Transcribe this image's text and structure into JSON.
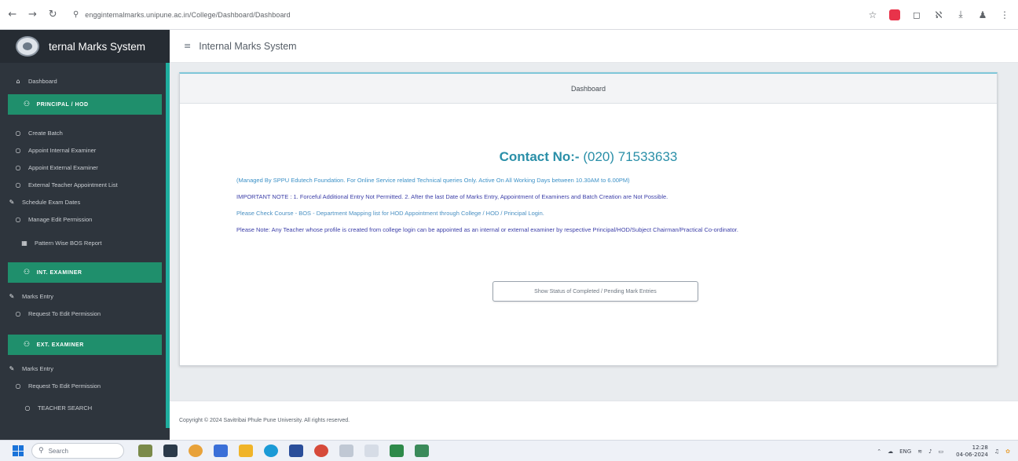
{
  "browser": {
    "url": "enggintemalmarks.unipune.ac.in/College/Dashboard/Dashboard",
    "back_icon": "arrow-left-icon",
    "forward_icon": "arrow-right-icon",
    "reload_icon": "reload-icon"
  },
  "sidebar": {
    "brand": "ternal Marks System",
    "dashboard": "Dashboard",
    "principal_head": "PRINCIPAL / HOD",
    "principal_items": [
      "Create Batch",
      "Appoint Internal Examiner",
      "Appoint External Examiner",
      "External Teacher Appointment List",
      "Schedule Exam Dates",
      "Manage Edit Permission",
      "Pattern Wise BOS Report"
    ],
    "int_head": "INT. EXAMINER",
    "int_items": [
      "Marks Entry",
      "Request To Edit Permission"
    ],
    "ext_head": "EXT. EXAMINER",
    "ext_items": [
      "Marks Entry",
      "Request To Edit Permission"
    ],
    "teacher_head": "TEACHER SEARCH"
  },
  "header": {
    "title": "Internal Marks System"
  },
  "card": {
    "title": "Dashboard",
    "contact_label": "Contact No:-",
    "contact_number": "(020) 71533633",
    "managed_note": "(Managed By SPPU Edutech Foundation. For Online Service related Technical queries Only. Active On All Working Days between 10.30AM to 6.00PM)",
    "important_note": "IMPORTANT NOTE : 1. Forceful Additional Entry Not Permitted. 2. After the last Date of Marks Entry, Appointment of Examiners and Batch Creation are Not Possible.",
    "bos_note": "Please Check Course - BOS - Department Mapping list for HOD Appointment through College / HOD / Principal Login.",
    "please_note": "Please Note: Any Teacher whose profile is created from college login can be appointed as an internal or external examiner by respective Principal/HOD/Subject Chairman/Practical Co-ordinator.",
    "status_button": "Show Status of Completed / Pending Mark Entries"
  },
  "footer": {
    "copyright": "Copyright © 2024 Savitribai Phule Pune University. All rights reserved."
  },
  "taskbar": {
    "search_placeholder": "Search",
    "lang": "ENG",
    "time": "12:28",
    "date": "04-06-2024"
  },
  "colors": {
    "sidebar_bg": "#2e353d",
    "section_head": "#1f8f6c",
    "accent_teal": "#2a8fa8",
    "note_blue": "#3c3fa8"
  }
}
